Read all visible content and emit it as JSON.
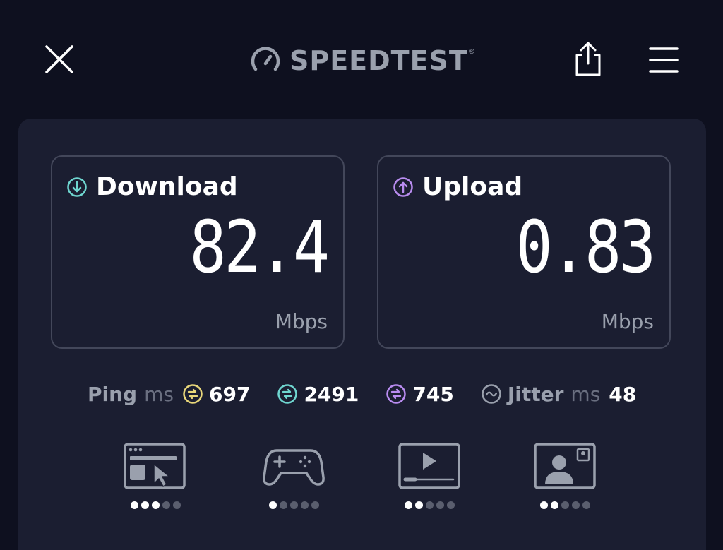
{
  "header": {
    "logo_text": "SPEEDTEST",
    "logo_tm": "®"
  },
  "download": {
    "title": "Download",
    "value": "82.4",
    "unit": "Mbps",
    "accent": "#6fd6d0"
  },
  "upload": {
    "title": "Upload",
    "value": "0.83",
    "unit": "Mbps",
    "accent": "#b98cf0"
  },
  "metrics": {
    "ping_label": "Ping",
    "ping_unit": "ms",
    "ping_idle": "697",
    "ping_download": "2491",
    "ping_upload": "745",
    "jitter_label": "Jitter",
    "jitter_unit": "ms",
    "jitter_value": "48",
    "idle_color": "#e9d77a",
    "download_color": "#6fd6d0",
    "upload_color": "#b98cf0"
  },
  "experiences": [
    {
      "name": "web-browsing",
      "icon": "browser-cursor-icon",
      "rating": 3,
      "max": 5
    },
    {
      "name": "gaming",
      "icon": "gamepad-icon",
      "rating": 1,
      "max": 5
    },
    {
      "name": "video-streaming",
      "icon": "video-play-icon",
      "rating": 2,
      "max": 5
    },
    {
      "name": "video-chat",
      "icon": "video-call-icon",
      "rating": 2,
      "max": 5
    }
  ]
}
